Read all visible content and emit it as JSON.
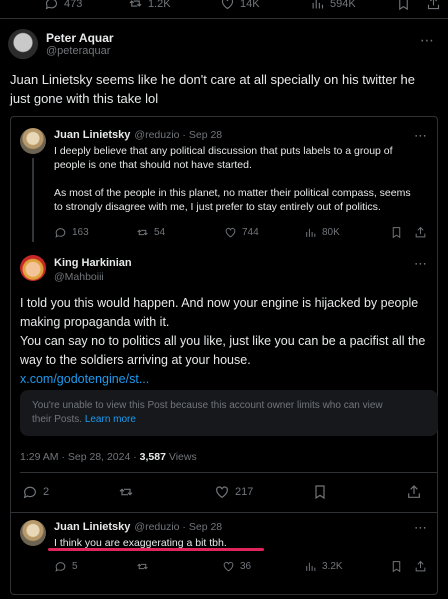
{
  "top_stats": {
    "replies": "473",
    "retweets": "1.2K",
    "likes": "14K",
    "views": "594K"
  },
  "main_post": {
    "name": "Peter Aquar",
    "handle": "@peteraquar",
    "text_line1": "Juan Linietsky seems like he don't care at all specially on his twitter he",
    "text_line2": "just gone with this take lol"
  },
  "quoted_post": {
    "name": "Juan Linietsky",
    "handle": "@reduzio · Sep 28",
    "para1_line1": "I deeply believe that any political discussion that puts labels to a group of",
    "para1_line2": "people is one that should not have started.",
    "para2_line1": "As most of the people in this planet, no matter their political compass, seems",
    "para2_line2": "to strongly disagree with me, I just prefer to stay entirely out of politics.",
    "stats": {
      "replies": "163",
      "retweets": "54",
      "likes": "744",
      "views": "80K"
    }
  },
  "reply_post": {
    "name": "King Harkinian",
    "handle": "@Mahboiii",
    "line1": "I told you this would happen. And now your engine is hijacked by people",
    "line2": "making propaganda with it.",
    "line3": "You can say no to politics all you like, just like you can be a pacifist all the",
    "line4": "way to the soldiers arriving at your house.",
    "link": "x.com/godotengine/st...",
    "notice_line1": "You're unable to view this Post because this account owner limits who can view",
    "notice_line2": "their Posts.",
    "notice_link": "Learn more",
    "timestamp": "1:29 AM · Sep 28, 2024 ·",
    "views_count": "3,587",
    "views_label": "Views",
    "stats": {
      "replies": "2",
      "likes": "217"
    }
  },
  "bottom_reply": {
    "name": "Juan Linietsky",
    "handle": "@reduzio · Sep 28",
    "text": "I think you are exaggerating a bit tbh.",
    "stats": {
      "replies": "5",
      "likes": "36",
      "views": "3.2K"
    }
  },
  "colors": {
    "background": "#000000",
    "text": "#e7e9ea",
    "muted": "#71767b",
    "link": "#1d9bf0",
    "underline": "#e0245e"
  }
}
